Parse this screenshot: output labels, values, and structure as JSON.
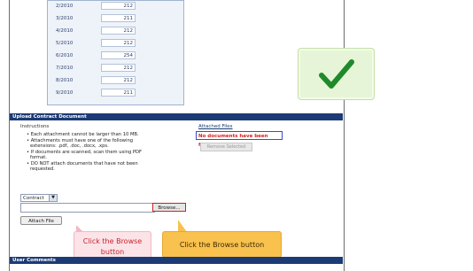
{
  "table": {
    "rows": [
      {
        "month": "2/2010",
        "value": "212"
      },
      {
        "month": "3/2010",
        "value": "211"
      },
      {
        "month": "4/2010",
        "value": "212"
      },
      {
        "month": "5/2010",
        "value": "212"
      },
      {
        "month": "6/2010",
        "value": "254"
      },
      {
        "month": "7/2010",
        "value": "212"
      },
      {
        "month": "8/2010",
        "value": "212"
      },
      {
        "month": "9/2010",
        "value": "211"
      }
    ]
  },
  "upload": {
    "section_title": "Upload Contract Document",
    "instructions_label": "Instructions",
    "bullets": [
      "Each attachment cannot be larger than 10 MB.",
      "Attachments must have one of the following",
      "extensions: .pdf, .doc, .docx, .xps.",
      "If documents are scanned, scan them using PDF",
      "format.",
      "DO NOT attach documents that have not been",
      "requested."
    ],
    "attached_files_label": "Attached Files",
    "no_documents": "No documents have been found.",
    "remove_selected": "Remove Selected",
    "doc_type_value": "Contract",
    "browse_label": "Browse...",
    "attach_label": "Attach File"
  },
  "callouts": {
    "primary": "Click the Browse button",
    "secondary": "Click the Browse button"
  },
  "comments": {
    "section_title": "User Comments"
  },
  "colors": {
    "header_bar": "#1c3a75",
    "error_text": "#d42020",
    "highlight_border": "#3b4cc4",
    "callout_orange": "#f9c14d",
    "check_green": "#1f8a2b"
  },
  "icons": {
    "checkmark": "check-icon"
  }
}
